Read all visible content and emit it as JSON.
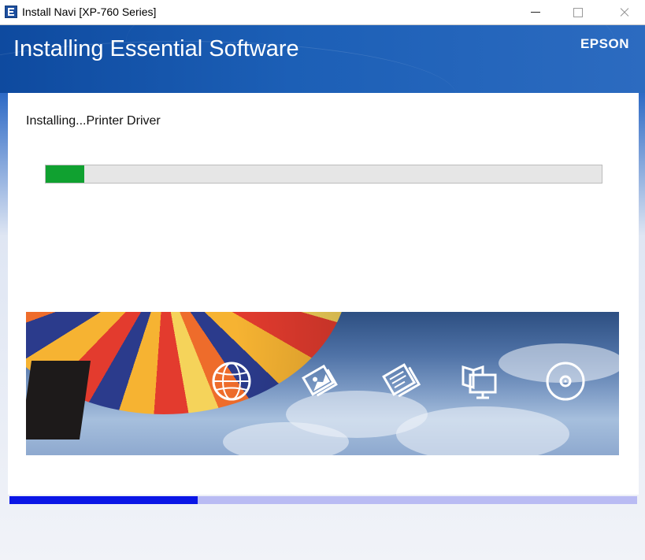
{
  "window": {
    "title": "Install Navi [XP-760 Series]",
    "icon": "epson-app-icon",
    "controls": [
      "minimize-icon",
      "maximize-icon",
      "close-icon"
    ]
  },
  "header": {
    "title": "Installing Essential Software",
    "logo": "EPSON"
  },
  "status": {
    "message": "Installing...Printer Driver",
    "progress_fraction": 0.07
  },
  "banner": {
    "icons": [
      "globe-icon",
      "photo-print-icon",
      "document-scan-icon",
      "manual-screen-icon",
      "disc-icon"
    ]
  },
  "step_progress": {
    "fraction": 0.3,
    "color": "#0a16e6",
    "track_color": "#b9bbf3"
  },
  "colors": {
    "header_blue": "#1c5fb6",
    "progress_green": "#10a130"
  }
}
